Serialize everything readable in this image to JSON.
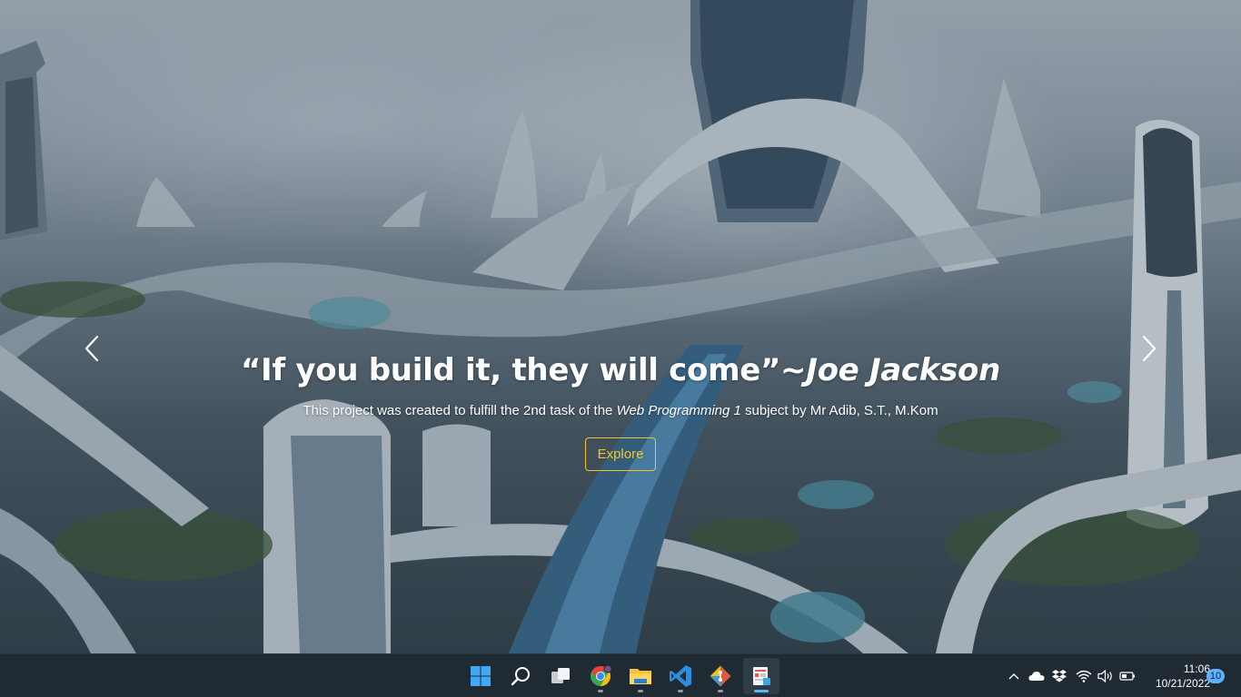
{
  "hero": {
    "quote": "“If you build it, they will come”",
    "author": "~Joe Jackson",
    "description_prefix": "This project was created to fulfill the 2nd task of the ",
    "description_subject": "Web Programming 1",
    "description_suffix": " subject by Mr Adib, S.T., M.Kom",
    "button_label": "Explore",
    "button_color": "#f4c22b"
  },
  "carousel": {
    "prev_icon": "chevron-left-icon",
    "next_icon": "chevron-right-icon"
  },
  "taskbar": {
    "apps": [
      {
        "name": "start",
        "icon": "windows-logo-icon"
      },
      {
        "name": "search",
        "icon": "search-icon"
      },
      {
        "name": "task-view",
        "icon": "task-view-icon"
      },
      {
        "name": "chrome",
        "icon": "chrome-icon"
      },
      {
        "name": "file-explorer",
        "icon": "folder-icon"
      },
      {
        "name": "vscode",
        "icon": "vscode-icon"
      },
      {
        "name": "git-client",
        "icon": "git-icon"
      },
      {
        "name": "active-app",
        "icon": "app-icon"
      }
    ],
    "tray": {
      "time": "11:06",
      "date": "10/21/2022",
      "notification_count": "10",
      "accent_color": "#5fb2ff"
    }
  }
}
